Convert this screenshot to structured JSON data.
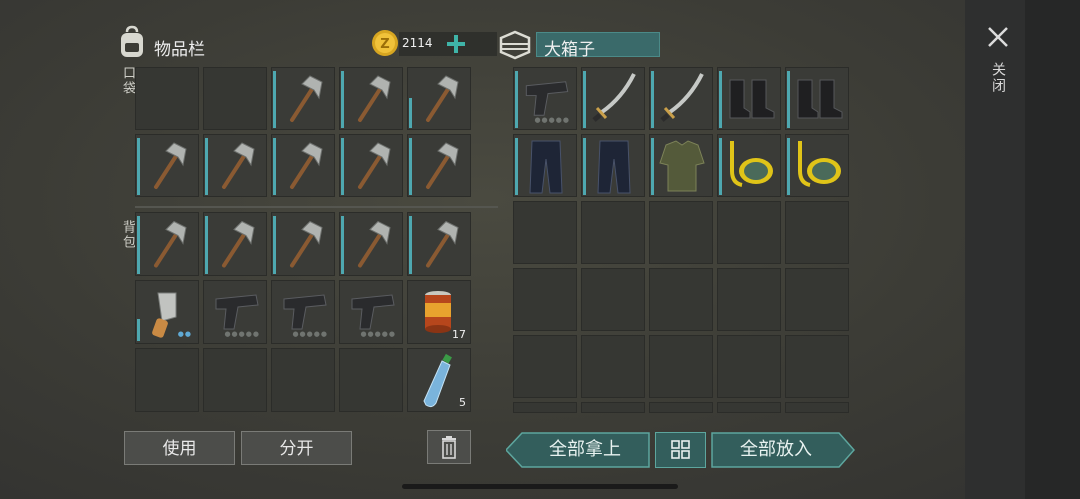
{
  "inventory": {
    "title": "物品栏",
    "coins": "2114",
    "pocket_label": "口袋",
    "backpack_label": "背包",
    "food_qty": "17",
    "water_qty": "5"
  },
  "container": {
    "title": "大箱子"
  },
  "buttons": {
    "use": "使用",
    "split": "分开",
    "take_all": "全部拿上",
    "put_all": "全部放入"
  },
  "close": {
    "label": "关闭"
  }
}
